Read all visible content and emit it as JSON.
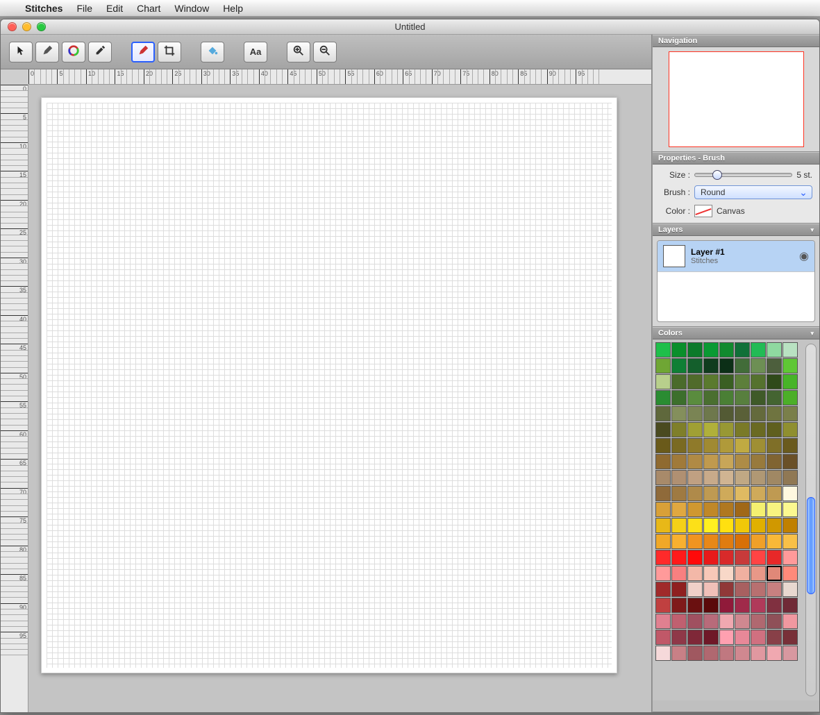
{
  "menubar": {
    "app": "Stitches",
    "items": [
      "File",
      "Edit",
      "Chart",
      "Window",
      "Help"
    ]
  },
  "window": {
    "title": "Untitled"
  },
  "toolbar": {
    "tools": [
      {
        "name": "pointer",
        "glyph": "↖",
        "active": false
      },
      {
        "name": "pencil",
        "glyph": "✎",
        "active": false
      },
      {
        "name": "color-wheel",
        "glyph": "◉",
        "active": false
      },
      {
        "name": "eyedropper",
        "glyph": "✑",
        "active": false
      },
      {
        "name": "brush",
        "glyph": "/",
        "active": true
      },
      {
        "name": "crop",
        "glyph": "◫",
        "active": false
      },
      {
        "name": "fill",
        "glyph": "🪣",
        "active": false
      },
      {
        "name": "text",
        "glyph": "Aa",
        "active": false
      },
      {
        "name": "zoom-in",
        "glyph": "＋",
        "active": false
      },
      {
        "name": "zoom-out",
        "glyph": "－",
        "active": false
      }
    ]
  },
  "ruler": {
    "h_labels": [
      "0",
      "5",
      "10",
      "15",
      "20",
      "25",
      "30",
      "35",
      "40",
      "45",
      "50",
      "55",
      "60",
      "65",
      "70",
      "75",
      "80",
      "85",
      "90",
      "95"
    ],
    "v_labels": [
      "0",
      "5",
      "10",
      "15",
      "20",
      "25",
      "30",
      "35",
      "40",
      "45",
      "50",
      "55",
      "60",
      "65",
      "70",
      "75",
      "80",
      "85",
      "90",
      "95"
    ]
  },
  "panels": {
    "navigation": {
      "title": "Navigation"
    },
    "properties": {
      "title": "Properties - Brush",
      "size_label": "Size :",
      "size_value": "5 st.",
      "brush_label": "Brush :",
      "brush_value": "Round",
      "color_label": "Color :",
      "color_value": "Canvas"
    },
    "layers": {
      "title": "Layers",
      "layer1_name": "Layer #1",
      "layer1_type": "Stitches"
    },
    "colors": {
      "title": "Colors",
      "rows": [
        [
          "#1fbf4a",
          "#0a8f2b",
          "#0c7a2a",
          "#0a9a33",
          "#118a2e",
          "#107038",
          "#22bb55",
          "#8fd9a0",
          "#b9e2c2"
        ],
        [
          "#6fa634",
          "#0f7f35",
          "#145f2c",
          "#103c1e",
          "#0c2f17",
          "#426c39",
          "#6d8f54",
          "#4d5f3d",
          "#5fc735"
        ],
        [
          "#b8cf8c",
          "#4a6b2b",
          "#506b2a",
          "#5a7a2e",
          "#3a5f22",
          "#5d7f3b",
          "#55722e",
          "#2f4a1a",
          "#47b428"
        ],
        [
          "#2a8c32",
          "#3c6f2c",
          "#5a8c3e",
          "#4a6f30",
          "#4a7f35",
          "#587f3e",
          "#3f5a28",
          "#446431",
          "#4caf28"
        ],
        [
          "#5f683c",
          "#848f5c",
          "#7a8454",
          "#6e784c",
          "#535a34",
          "#5a6038",
          "#646a3c",
          "#6f7440",
          "#7a7f4a"
        ],
        [
          "#4a4a20",
          "#7f7f2a",
          "#a0a034",
          "#b0b03a",
          "#989834",
          "#7a7a28",
          "#6a6a22",
          "#5f5f1e",
          "#8f8f30"
        ],
        [
          "#6a5a1a",
          "#7a6a22",
          "#8f7a2a",
          "#a08a32",
          "#b09a3a",
          "#c0aa42",
          "#9f8f34",
          "#7f6f28",
          "#6a5a1e"
        ],
        [
          "#8f6a30",
          "#a07a3a",
          "#b08a44",
          "#c09a4e",
          "#c8a658",
          "#ae8c46",
          "#987a3c",
          "#806432",
          "#6a5028"
        ],
        [
          "#a88a6a",
          "#b09072",
          "#c0a082",
          "#c8aa8a",
          "#d0b492",
          "#c0a884",
          "#b09874",
          "#a08864",
          "#907854"
        ],
        [
          "#8f6a3a",
          "#9f7a42",
          "#af8a4a",
          "#bf9a52",
          "#cfaa5a",
          "#dfba62",
          "#cfaa5a",
          "#bf9a52",
          "#fff8e0"
        ],
        [
          "#d8a038",
          "#e0a840",
          "#d09830",
          "#c08828",
          "#b07820",
          "#a06818",
          "#f4f070",
          "#f8f480",
          "#fcf890"
        ],
        [
          "#e8b818",
          "#f4d018",
          "#fce018",
          "#fff020",
          "#ffe010",
          "#f0c808",
          "#e0b000",
          "#d09800",
          "#c08000"
        ],
        [
          "#f0a828",
          "#f8b030",
          "#f09420",
          "#e88818",
          "#e07c10",
          "#d87008",
          "#f0a028",
          "#f8b838",
          "#f8c048"
        ],
        [
          "#ff2a2a",
          "#ff1a1a",
          "#ff0a0a",
          "#e81a1a",
          "#d82a2a",
          "#c83a3a",
          "#ff4444",
          "#e82828",
          "#ff9a9a"
        ],
        [
          "#ff9a9a",
          "#f88080",
          "#f3b8a8",
          "#f8c8b8",
          "#f8d8c8",
          "#f0b0a0",
          "#e89888",
          "#e08878",
          "#ff8a7a"
        ],
        [
          "#a02a2a",
          "#8f2020",
          "#f0d0c8",
          "#f0c0b8",
          "#903838",
          "#a86060",
          "#b87070",
          "#c88080",
          "#e8d8d0"
        ],
        [
          "#c04040",
          "#7f1a1a",
          "#6a1010",
          "#5a0a0a",
          "#901a3a",
          "#a02a4a",
          "#b03a5a",
          "#803040",
          "#702a36"
        ],
        [
          "#e08090",
          "#c06070",
          "#a05060",
          "#b86b7a",
          "#f0a8b0",
          "#d08890",
          "#b06870",
          "#8f5058",
          "#f098a0"
        ],
        [
          "#c05868",
          "#8f3848",
          "#7f2838",
          "#6f1828",
          "#ffa0b0",
          "#e88898",
          "#d07080",
          "#884048",
          "#783038"
        ],
        [
          "#f6d9da",
          "#c88086",
          "#a05860",
          "#b06870",
          "#c07880",
          "#d08890",
          "#e098a0",
          "#f0a8b0",
          "#d898a0"
        ]
      ],
      "selected": [
        14,
        7
      ]
    }
  }
}
